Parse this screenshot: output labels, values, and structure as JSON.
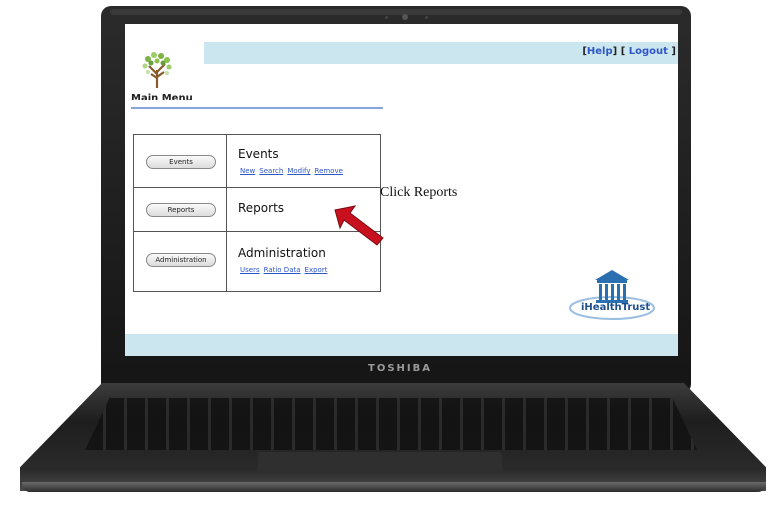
{
  "device": {
    "brand": "TOSHIBA"
  },
  "app": {
    "top_links": {
      "help": "Help",
      "logout": "Logout"
    },
    "menu_title": "Main Menu",
    "rows": [
      {
        "button": "Events",
        "label": "Events",
        "links": [
          "New",
          "Search",
          "Modify",
          "Remove"
        ]
      },
      {
        "button": "Reports",
        "label": "Reports",
        "links": []
      },
      {
        "button": "Administration",
        "label": "Administration",
        "links": [
          "Users",
          "Ratio Data",
          "Export"
        ]
      }
    ],
    "logo_text": {
      "part1": "iHealth",
      "part2": "Trust"
    }
  },
  "annotation": {
    "text": "Click Reports"
  },
  "colors": {
    "top_bar": "#cbe6ef",
    "link": "#2f57c8",
    "arrow": "#c8101e"
  }
}
